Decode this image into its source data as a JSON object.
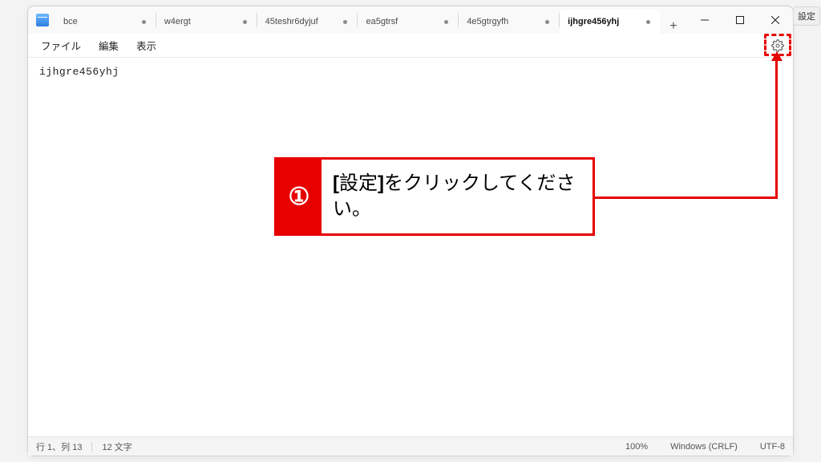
{
  "settings_badge": "設定",
  "tabs": [
    {
      "label": "bce",
      "modified": true
    },
    {
      "label": "w4ergt",
      "modified": true
    },
    {
      "label": "45teshr6dyjuf",
      "modified": true
    },
    {
      "label": "ea5gtrsf",
      "modified": true
    },
    {
      "label": "4e5gtrgyfh",
      "modified": true
    },
    {
      "label": "ijhgre456yhj",
      "modified": true,
      "active": true
    }
  ],
  "newtab_label": "+",
  "menu": {
    "file": "ファイル",
    "edit": "編集",
    "view": "表示"
  },
  "editor_content": "ijhgre456yhj",
  "status": {
    "position": "行 1、列 13",
    "chars": "12 文字",
    "zoom": "100%",
    "eol": "Windows (CRLF)",
    "encoding": "UTF-8"
  },
  "callout": {
    "number": "①",
    "text": "[設定]をクリックしてください。"
  }
}
